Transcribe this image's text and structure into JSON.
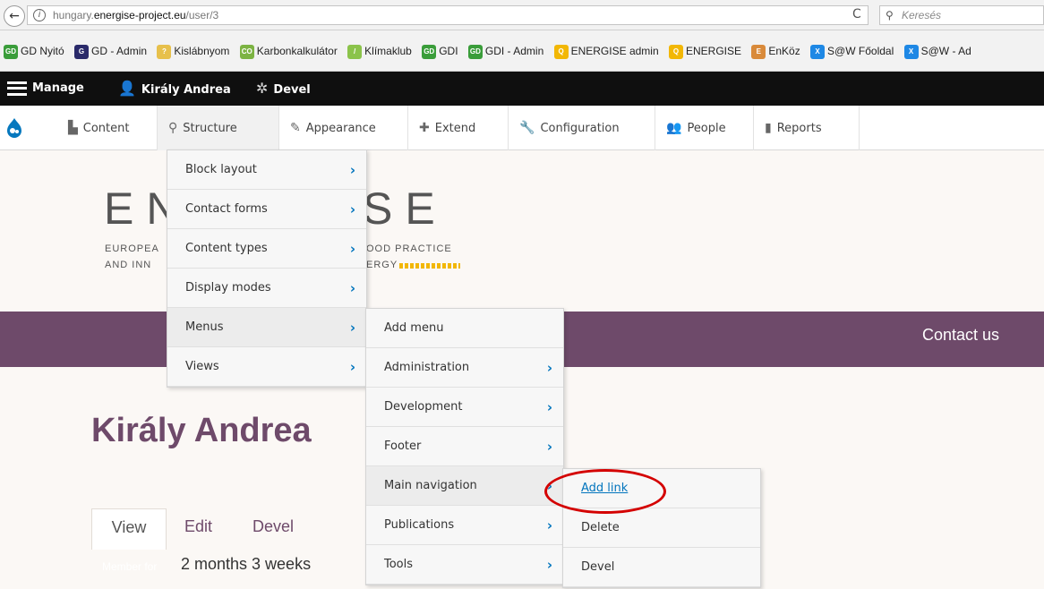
{
  "browser": {
    "back_glyph": "←",
    "info_glyph": "i",
    "url_prefix": "hungary.",
    "url_domain": "energise-project.eu",
    "url_path": "/user/3",
    "reload_glyph": "C",
    "search_glyph": "⚲",
    "search_placeholder": "Keresés"
  },
  "bookmarks": [
    {
      "label": "GD Nyitó",
      "icon": "gd-icon",
      "color": "#3a9d3a",
      "glyph": "GD"
    },
    {
      "label": "GD - Admin",
      "icon": "gd-admin-icon",
      "color": "#2a2a6a",
      "glyph": "G"
    },
    {
      "label": "Kislábnyom",
      "icon": "footprint-icon",
      "color": "#e7c04b",
      "glyph": "?"
    },
    {
      "label": "Karbonkalkulátor",
      "icon": "co2-icon",
      "color": "#7cb342",
      "glyph": "CO"
    },
    {
      "label": "Klímaklub",
      "icon": "klimaklub-icon",
      "color": "#8bc34a",
      "glyph": "/"
    },
    {
      "label": "GDI",
      "icon": "gdi-icon",
      "color": "#3a9d3a",
      "glyph": "GD"
    },
    {
      "label": "GDI - Admin",
      "icon": "gdi-admin-icon",
      "color": "#3a9d3a",
      "glyph": "GD"
    },
    {
      "label": "ENERGISE admin",
      "icon": "bulb-icon",
      "color": "#f2b705",
      "glyph": "Q"
    },
    {
      "label": "ENERGISE",
      "icon": "bulb-icon",
      "color": "#f2b705",
      "glyph": "Q"
    },
    {
      "label": "EnKöz",
      "icon": "enkoz-icon",
      "color": "#d98a3a",
      "glyph": "E"
    },
    {
      "label": "S@W Főoldal",
      "icon": "saw-icon",
      "color": "#1e88e5",
      "glyph": "X"
    },
    {
      "label": "S@W - Ad",
      "icon": "saw-icon",
      "color": "#1e88e5",
      "glyph": "X"
    }
  ],
  "toolbar": {
    "manage": "Manage",
    "user": "Király Andrea",
    "devel": "Devel",
    "user_glyph": "👤",
    "devel_glyph": "✲"
  },
  "tray": {
    "content": "Content",
    "structure": "Structure",
    "appearance": "Appearance",
    "extend": "Extend",
    "configuration": "Configuration",
    "people": "People",
    "reports": "Reports",
    "glyphs": {
      "content": "▙",
      "structure": "⚲",
      "appearance": "✎",
      "extend": "✚",
      "configuration": "🔧",
      "people": "👥",
      "reports": "▮"
    }
  },
  "site": {
    "logo_left": "EN",
    "logo_right": "SE",
    "tagline_left_1": "EUROPEA",
    "tagline_left_2": "AND INN",
    "tagline_right_1": "OOD PRACTICE",
    "tagline_right_2": "ERGY",
    "contact_us": "Contact us",
    "page_title": "Király Andrea",
    "tabs": {
      "view": "View",
      "edit": "Edit",
      "devel": "Devel"
    },
    "member_label": "Member for",
    "member_value": "2 months 3 weeks"
  },
  "colors": {
    "brand_purple": "#6e4a6a",
    "brand_yellow": "#f2b705",
    "link_blue": "#0074bd",
    "annotation_red": "#d40000"
  },
  "menus": {
    "structure": [
      "Block layout",
      "Contact forms",
      "Content types",
      "Display modes",
      "Menus",
      "Views"
    ],
    "menus": [
      "Add menu",
      "Administration",
      "Development",
      "Footer",
      "Main navigation",
      "Publications",
      "Tools"
    ],
    "main_navigation": [
      "Add link",
      "Delete",
      "Devel"
    ]
  },
  "chevron": "›"
}
